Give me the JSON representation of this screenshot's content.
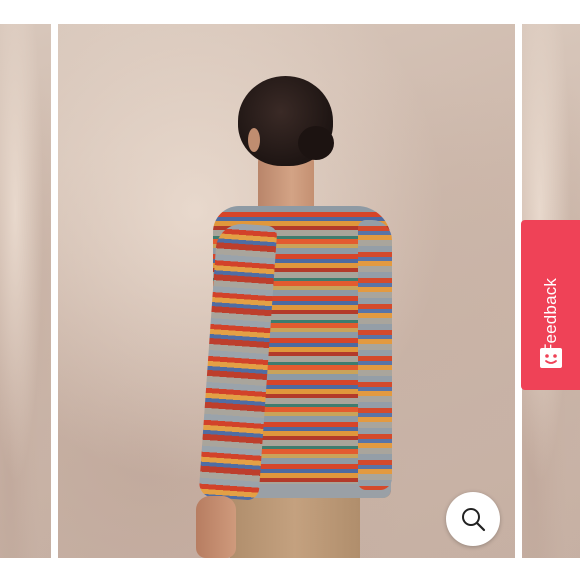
{
  "gallery": {
    "slides": [
      {
        "id": "prev"
      },
      {
        "id": "current"
      },
      {
        "id": "next"
      }
    ],
    "zoom_icon": "magnifier-icon"
  },
  "feedback": {
    "label": "Feedback",
    "icon": "smiley-face-icon",
    "background_color": "#ef4257",
    "text_color": "#ffffff"
  }
}
